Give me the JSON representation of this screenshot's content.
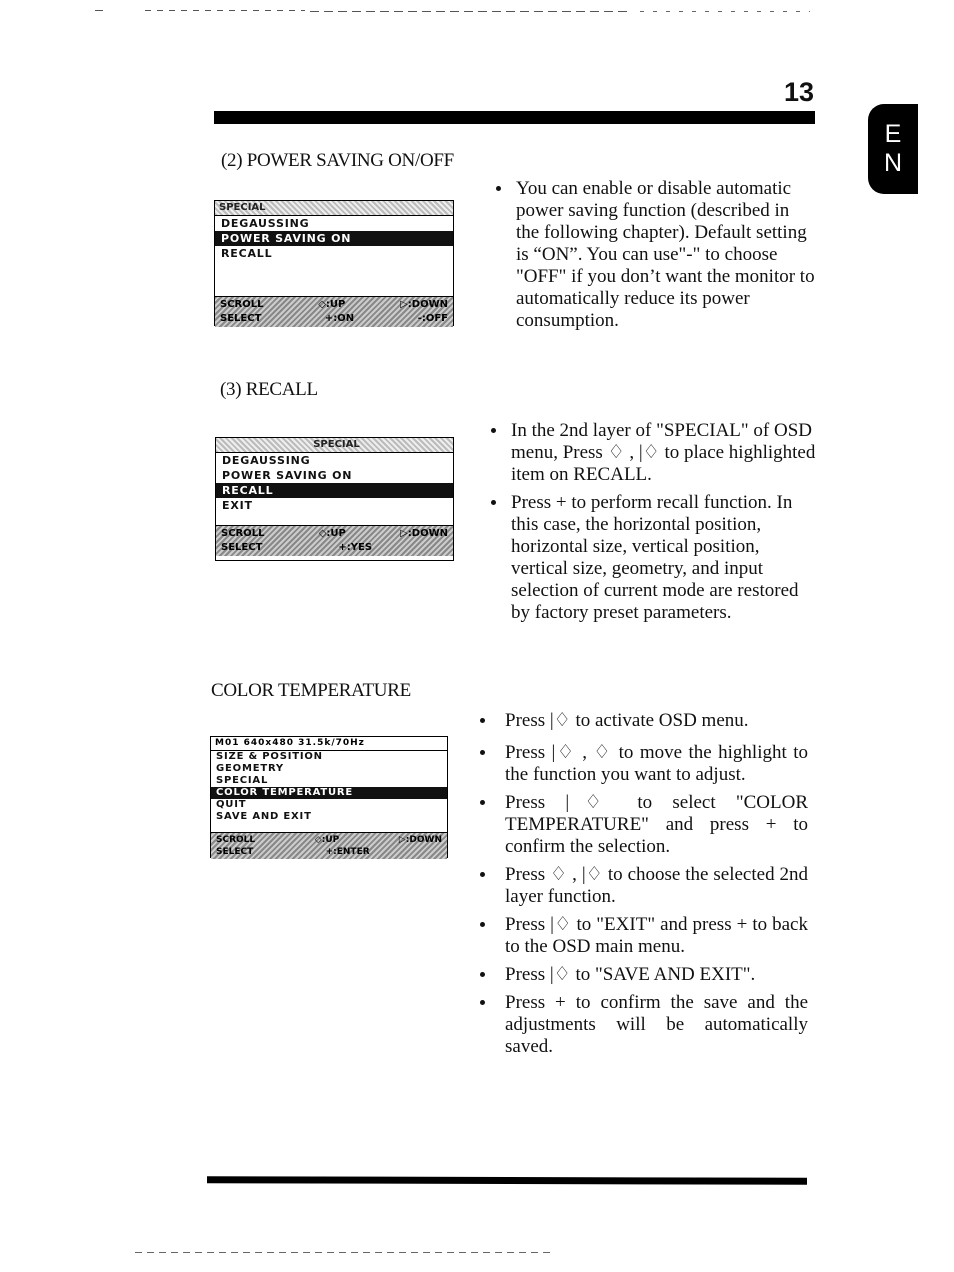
{
  "page": {
    "number": "13",
    "language_tab": [
      "E",
      "N"
    ]
  },
  "sections": {
    "power_saving": {
      "title": "(2) POWER SAVING ON/OFF",
      "osd": {
        "header": "SPECIAL",
        "items": [
          "DEGAUSSING",
          "POWER SAVING ON",
          "RECALL"
        ],
        "selected_index": 1,
        "footer": [
          {
            "left": "SCROLL",
            "mid": "◇:UP",
            "right": "▷:DOWN"
          },
          {
            "left": "SELECT",
            "mid": "+:ON",
            "right": "-:OFF"
          }
        ]
      },
      "bullets": [
        "You can enable or disable automatic power saving function (described in the following chapter). Default setting is “ON”. You can use\"-\" to choose \"OFF\" if you don’t want the monitor to automatically reduce its power consumption."
      ]
    },
    "recall": {
      "title": "(3) RECALL",
      "osd": {
        "header": "SPECIAL",
        "items": [
          "DEGAUSSING",
          "POWER SAVING ON",
          "RECALL",
          "EXIT"
        ],
        "selected_index": 2,
        "footer": [
          {
            "left": "SCROLL",
            "mid": "◇:UP",
            "right": "▷:DOWN"
          },
          {
            "left": "SELECT",
            "mid": "+:YES",
            "right": ""
          }
        ]
      },
      "bullets": [
        "In the 2nd layer of \"SPECIAL\" of OSD menu, Press ♢ , |♢ to place highlighted item on RECALL.",
        "Press + to perform recall function. In this case, the horizontal position, horizontal size, vertical position, vertical size, geometry, and input selection of current mode are restored by factory preset parameters."
      ]
    },
    "color_temperature": {
      "title": "COLOR TEMPERATURE",
      "osd": {
        "header": "M01  640x480  31.5k/70Hz",
        "items": [
          "SIZE & POSITION",
          "GEOMETRY",
          "SPECIAL",
          "COLOR TEMPERATURE",
          "QUIT",
          "SAVE AND EXIT"
        ],
        "selected_index": 3,
        "footer": [
          {
            "left": "SCROLL",
            "mid": "◇:UP",
            "right": "▷:DOWN"
          },
          {
            "left": "SELECT",
            "mid": "+:ENTER",
            "right": ""
          }
        ]
      },
      "bullets": [
        "Press |♢ to activate OSD menu.",
        "Press |♢ , ♢ to move the highlight to the function you want to adjust.",
        "Press |♢ to select \"COLOR TEMPERATURE\" and press + to confirm the selection.",
        "Press ♢ , |♢ to choose the selected 2nd layer function.",
        "Press |♢ to \"EXIT\" and press + to back to the OSD main menu.",
        "Press |♢ to \"SAVE AND EXIT\".",
        "Press + to confirm the save and the adjustments will be automatically saved."
      ]
    }
  }
}
